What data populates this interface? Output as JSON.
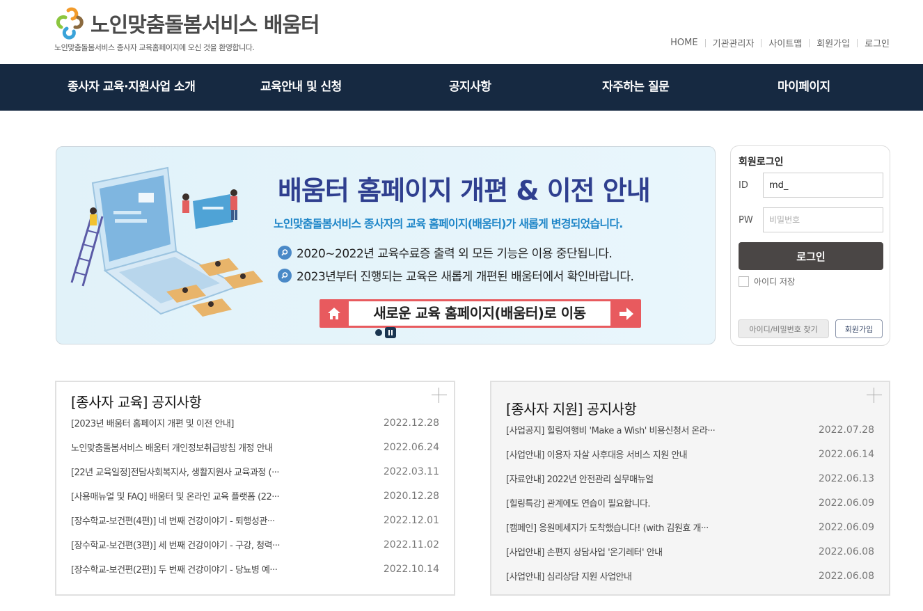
{
  "header": {
    "site_title": "노인맞춤돌봄서비스 배움터",
    "site_subtitle": "노인맞춤돌봄서비스 종사자 교육홈페이지에 오신 것을 환영합니다.",
    "util_links": [
      "HOME",
      "기관관리자",
      "사이트맵",
      "회원가입",
      "로그인"
    ]
  },
  "nav": {
    "items": [
      "종사자 교육·지원사업 소개",
      "교육안내 및 신청",
      "공지사항",
      "자주하는 질문",
      "마이페이지"
    ]
  },
  "banner": {
    "title": "배움터 홈페이지 개편 & 이전 안내",
    "subtitle": "노인맞춤돌봄서비스 종사자의 교육 홈페이지(배움터)가 새롭게 변경되었습니다.",
    "line1": "2020~2022년 교육수료증 출력 외 모든 기능은 이용 중단됩니다.",
    "line2": "2023년부터 진행되는 교육은 새롭게 개편된 배움터에서 확인바랍니다.",
    "button": "새로운 교육 홈페이지(배움터)로 이동"
  },
  "login": {
    "title": "회원로그인",
    "id_label": "ID",
    "id_value": "md_",
    "pw_label": "PW",
    "pw_placeholder": "비밀번호",
    "login_button": "로그인",
    "save_id": "아이디 저장",
    "find_button": "아이디/비밀번호 찾기",
    "join_button": "회원가입"
  },
  "notice_edu": {
    "title": "[종사자 교육] 공지사항",
    "items": [
      {
        "title": "[2023년 배움터 홈페이지 개편 및 이전 안내]",
        "date": "2022.12.28"
      },
      {
        "title": "노인맞춤돌봄서비스 배움터 개인정보취급방침 개정 안내",
        "date": "2022.06.24"
      },
      {
        "title": "[22년 교육일정]전담사회복지사, 생활지원사 교육과정 (···",
        "date": "2022.03.11"
      },
      {
        "title": "[사용매뉴얼 및 FAQ] 배움터 및 온라인 교육 플랫폼 (22···",
        "date": "2020.12.28"
      },
      {
        "title": "[장수학교-보건편(4편)] 네 번째 건강이야기 - 퇴행성관···",
        "date": "2022.12.01"
      },
      {
        "title": "[장수학교-보건편(3편)] 세 번째 건강이야기 - 구강, 청력···",
        "date": "2022.11.02"
      },
      {
        "title": "[장수학교-보건편(2편)] 두 번째 건강이야기 - 당뇨병 예···",
        "date": "2022.10.14"
      }
    ]
  },
  "notice_support": {
    "title": "[종사자 지원] 공지사항",
    "items": [
      {
        "title": "[사업공지] 힐링여행비 'Make a Wish' 비용신청서 온라···",
        "date": "2022.07.28"
      },
      {
        "title": "[사업안내] 이용자 자살 사후대응 서비스 지원 안내",
        "date": "2022.06.14"
      },
      {
        "title": "[자료안내] 2022년 안전관리 실무매뉴얼",
        "date": "2022.06.13"
      },
      {
        "title": "[힐링특강] 관계에도 연습이 필요합니다.",
        "date": "2022.06.09"
      },
      {
        "title": "[캠페인] 응원메세지가 도착했습니다! (with 김원효 개···",
        "date": "2022.06.09"
      },
      {
        "title": "[사업안내] 손편지 상담사업 '온기레터' 안내",
        "date": "2022.06.08"
      },
      {
        "title": "[사업안내] 심리상담 지원 사업안내",
        "date": "2022.06.08"
      }
    ]
  },
  "colors": {
    "nav_bg": "#162941",
    "banner_title": "#2f3f8f",
    "banner_subtitle": "#1f86c8",
    "banner_button": "#e85a5e",
    "login_button": "#4a4645"
  }
}
